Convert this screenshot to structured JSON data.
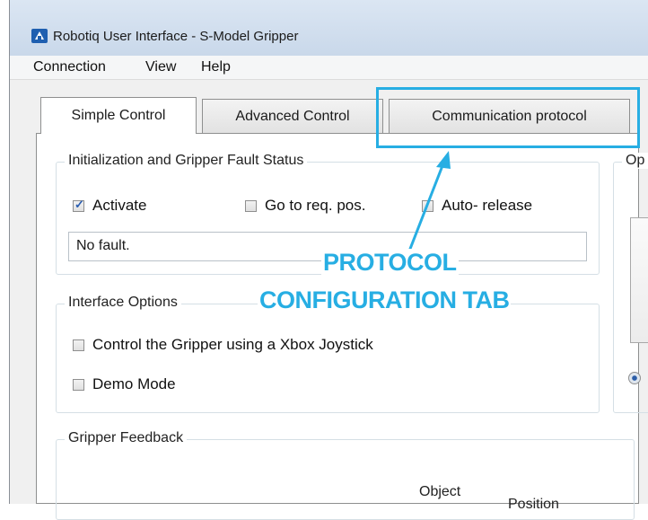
{
  "window": {
    "title": "Robotiq User Interface - S-Model Gripper",
    "icon": "robotiq-app-icon"
  },
  "menubar": {
    "items": [
      "Connection",
      "View",
      "Help"
    ]
  },
  "tabs": [
    {
      "label": "Simple Control",
      "active": true
    },
    {
      "label": "Advanced Control",
      "active": false
    },
    {
      "label": "Communication protocol",
      "active": false
    }
  ],
  "fault_group": {
    "title": "Initialization and Gripper Fault Status",
    "activate": {
      "label": "Activate",
      "checked": true
    },
    "go_to_req": {
      "label": "Go to req. pos.",
      "checked": false
    },
    "auto_release": {
      "label": "Auto- release",
      "checked": false
    },
    "status_text": "No fault."
  },
  "options_group": {
    "title_partial": "Op"
  },
  "interface_group": {
    "title": "Interface Options",
    "xbox": {
      "label": "Control the Gripper using a Xbox Joystick",
      "checked": false
    },
    "demo": {
      "label": "Demo Mode",
      "checked": false
    }
  },
  "feedback_group": {
    "title": "Gripper Feedback",
    "col_object": "Object",
    "col_position": "Position"
  },
  "annotation": {
    "line1": "PROTOCOL",
    "line2": "CONFIGURATION TAB",
    "color": "#27aee3"
  }
}
